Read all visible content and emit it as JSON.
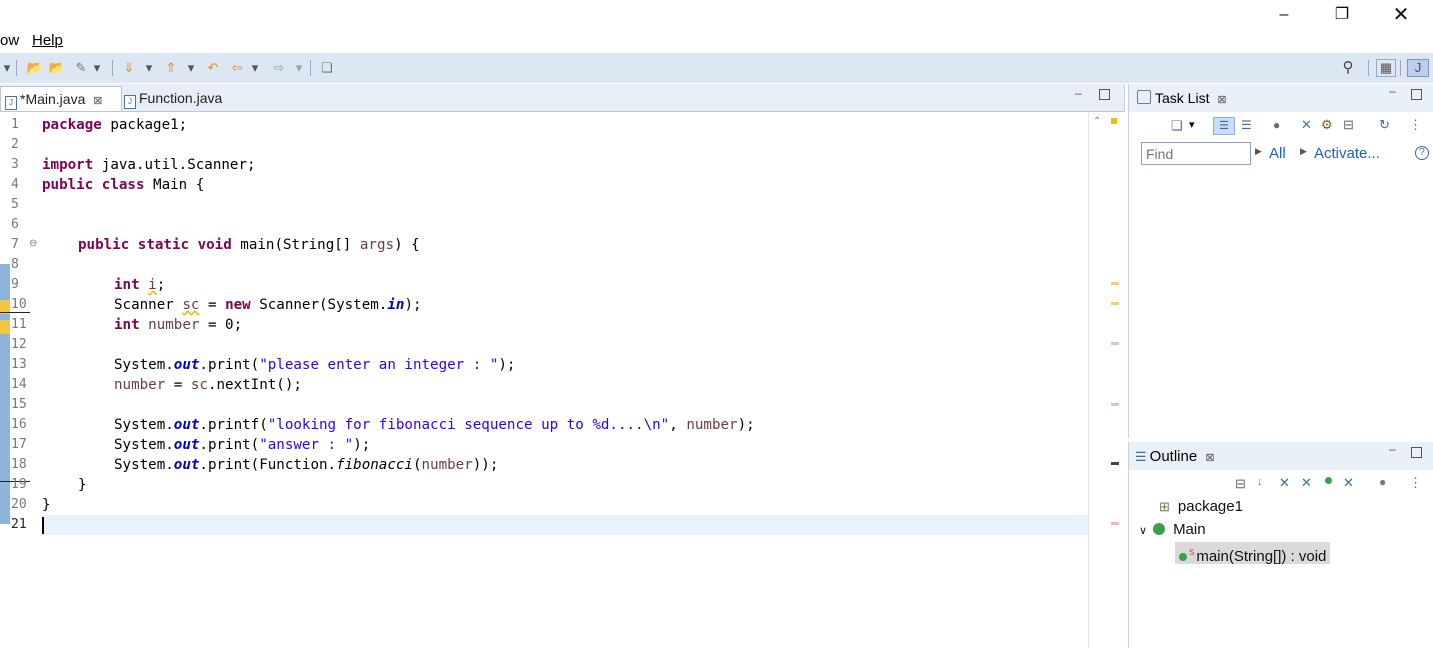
{
  "menu": {
    "items": [
      "ow",
      "Help"
    ]
  },
  "editor": {
    "tabs": [
      {
        "label": "*Main.java",
        "close": "⊠"
      },
      {
        "label": "Function.java"
      }
    ],
    "lines": [
      {
        "n": "1"
      },
      {
        "n": "2"
      },
      {
        "n": "3"
      },
      {
        "n": "4"
      },
      {
        "n": "5"
      },
      {
        "n": "6"
      },
      {
        "n": "7"
      },
      {
        "n": "8"
      },
      {
        "n": "9"
      },
      {
        "n": "10"
      },
      {
        "n": "11"
      },
      {
        "n": "12"
      },
      {
        "n": "13"
      },
      {
        "n": "14"
      },
      {
        "n": "15"
      },
      {
        "n": "16"
      },
      {
        "n": "17"
      },
      {
        "n": "18"
      },
      {
        "n": "19"
      },
      {
        "n": "20"
      },
      {
        "n": "21"
      }
    ]
  },
  "code": {
    "l1": [
      "package",
      " package1;"
    ],
    "l3": [
      "import",
      " java.util.Scanner;"
    ],
    "l4": [
      "public",
      " ",
      "class",
      " Main {"
    ],
    "l7": [
      "public",
      " ",
      "static",
      " ",
      "void",
      " main(String[] ",
      "args",
      ") {"
    ],
    "l9": [
      "int",
      " ",
      "i",
      ";"
    ],
    "l10": [
      "Scanner ",
      "sc",
      " = ",
      "new",
      " Scanner(System.",
      "in",
      ");"
    ],
    "l11": [
      "int",
      " ",
      "number",
      " = 0;"
    ],
    "l13": [
      "System.",
      "out",
      ".print(",
      "\"please enter an integer : \"",
      ");"
    ],
    "l14": [
      "number",
      " = ",
      "sc",
      ".nextInt();"
    ],
    "l16": [
      "System.",
      "out",
      ".printf(",
      "\"looking for fibonacci sequence up to %d....\\n\"",
      ", ",
      "number",
      ");"
    ],
    "l17": [
      "System.",
      "out",
      ".print(",
      "\"answer : \"",
      ");"
    ],
    "l18": [
      "System.",
      "out",
      ".print(Function.",
      "fibonacci",
      "(",
      "number",
      "));"
    ],
    "l19": [
      "}"
    ],
    "l20": [
      "}"
    ]
  },
  "task_list": {
    "title": "Task List",
    "close": "⊠",
    "find_placeholder": "Find",
    "all_link": "All",
    "activate_link": "Activate...",
    "help": "?"
  },
  "outline": {
    "title": "Outline",
    "close": "⊠",
    "package": "package1",
    "class": "Main",
    "method": "main(String[]) : void",
    "method_modifier": "S"
  },
  "icons": {
    "minimize": "minimize-icon",
    "maximize": "restore-icon",
    "close": "close-icon",
    "search": "search-icon"
  },
  "colors": {
    "keyword": "#7f0055",
    "string": "#2a00ff",
    "field": "#0000c0",
    "toolbar_bg": "#dde6f3",
    "current_line": "#e8f2fe"
  }
}
